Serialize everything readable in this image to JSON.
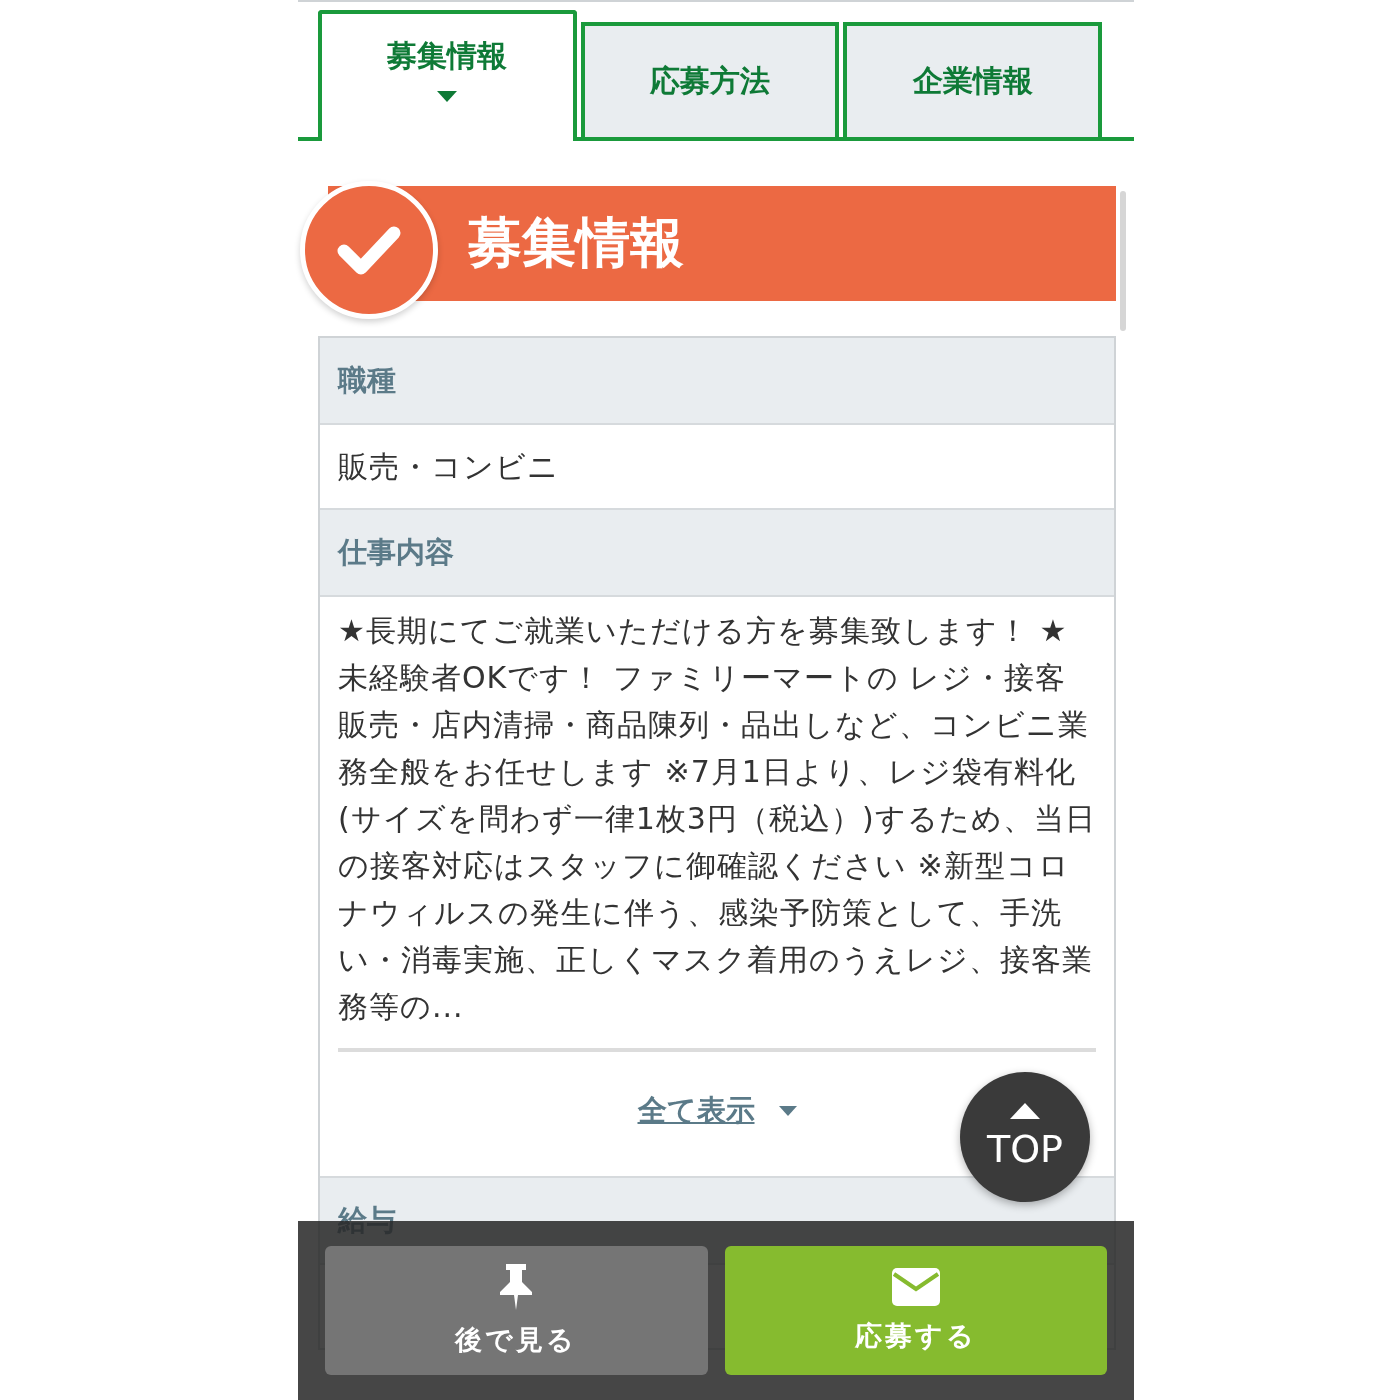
{
  "tabs": [
    {
      "label": "募集情報",
      "selected": true
    },
    {
      "label": "応募方法",
      "selected": false
    },
    {
      "label": "企業情報",
      "selected": false
    }
  ],
  "section_header": {
    "title": "募集情報"
  },
  "details": [
    {
      "heading": "職種",
      "value": "販売・コンビニ"
    },
    {
      "heading": "仕事内容",
      "value": "★長期にてご就業いただける方を募集致します！ ★未経験者OKです！ ファミリーマートの レジ・接客販売・店内清掃・商品陳列・品出しなど、コンビニ業務全般をお任せします ※7月1日より、レジ袋有料化(サイズを問わず一律1枚3円（税込）)するため、当日の接客対応はスタッフに御確認ください ※新型コロナウィルスの発生に伴う、感染予防策として、手洗い・消毒実施、正しくマスク着用のうえレジ、接客業務等の...",
      "show_all_link": "全て表示"
    },
    {
      "heading": "給与"
    }
  ],
  "top_button": {
    "label": "TOP"
  },
  "action_bar": {
    "buttons": [
      {
        "label": "後で見る",
        "kind": "later"
      },
      {
        "label": "応募する",
        "kind": "apply"
      }
    ]
  }
}
